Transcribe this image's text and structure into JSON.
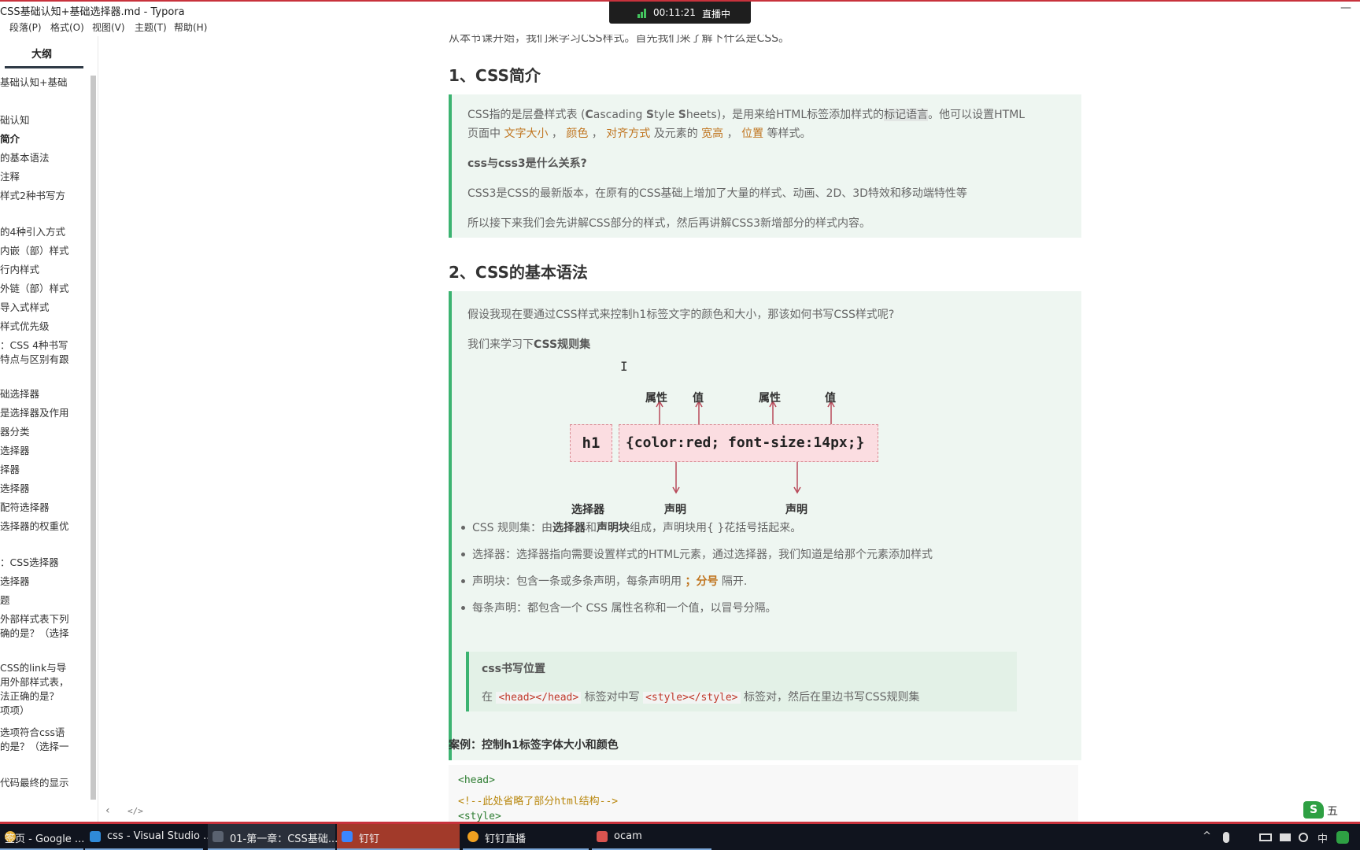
{
  "window": {
    "title": "CSS基础认知+基础选择器.md - Typora",
    "minimize_glyph": "—"
  },
  "live": {
    "time": "00:11:21",
    "label": "直播中"
  },
  "menu": [
    "段落(P)",
    "格式(O)",
    "视图(V)",
    "主题(T)",
    "帮助(H)"
  ],
  "sidebar": {
    "tab": "大纲",
    "items": [
      {
        "label": "基础认知+基础",
        "bold": false
      },
      {
        "label": "础认知",
        "bold": false
      },
      {
        "label": "简介",
        "bold": true
      },
      {
        "label": "的基本语法",
        "bold": false
      },
      {
        "label": "注释",
        "bold": false
      },
      {
        "label": "样式2种书写方",
        "bold": false
      },
      {
        "label": "的4种引入方式",
        "bold": false
      },
      {
        "label": "内嵌（部）样式",
        "bold": false
      },
      {
        "label": "行内样式",
        "bold": false
      },
      {
        "label": "外链（部）样式",
        "bold": false
      },
      {
        "label": "导入式样式",
        "bold": false
      },
      {
        "label": "样式优先级",
        "bold": false
      },
      {
        "label": "：CSS 4种书写",
        "bold": false
      },
      {
        "label": "特点与区别有跟",
        "bold": false
      },
      {
        "label": "础选择器",
        "bold": false
      },
      {
        "label": "是选择器及作用",
        "bold": false
      },
      {
        "label": "器分类",
        "bold": false
      },
      {
        "label": "选择器",
        "bold": false
      },
      {
        "label": "择器",
        "bold": false
      },
      {
        "label": "选择器",
        "bold": false
      },
      {
        "label": "配符选择器",
        "bold": false
      },
      {
        "label": "选择器的权重优",
        "bold": false
      },
      {
        "label": "：CSS选择器",
        "bold": false
      },
      {
        "label": "选择器",
        "bold": false
      },
      {
        "label": "题",
        "bold": false
      },
      {
        "label": "外部样式表下列",
        "bold": false
      },
      {
        "label": "确的是？（选择",
        "bold": false
      },
      {
        "label": "CSS的link与导",
        "bold": false
      },
      {
        "label": "用外部样式表，",
        "bold": false
      },
      {
        "label": "法正确的是？",
        "bold": false
      },
      {
        "label": "项项）",
        "bold": false
      },
      {
        "label": "选项符合css语",
        "bold": false
      },
      {
        "label": "的是？（选择一",
        "bold": false
      },
      {
        "label": "代码最终的显示",
        "bold": false
      }
    ],
    "footer_left": "‹",
    "footer_right": "</>"
  },
  "doc": {
    "cut_line": "从本节课开始，我们来学习CSS样式。首先我们来了解下什么是CSS。",
    "h1": "1、CSS简介",
    "intro": {
      "p1_a": "CSS指的是层叠样式表 (",
      "p1_C": "C",
      "p1_b": "ascading ",
      "p1_S": "S",
      "p1_c": "tyle ",
      "p1_S2": "S",
      "p1_d": "heets)，是用来给HTML标签添加样式的",
      "p1_hl": "标记语言",
      "p1_e": "。他可以设置HTML",
      "p2_a": "页面中 ",
      "p2_o1": "文字大小",
      "p2_s1": " ， ",
      "p2_o2": "颜色",
      "p2_s2": " ， ",
      "p2_o3": "对齐方式",
      "p2_b": " 及元素的 ",
      "p2_o4": "宽高",
      "p2_s3": " ， ",
      "p2_o5": "位置",
      "p2_c": " 等样式。",
      "q": "css与css3是什么关系?",
      "p3": "CSS3是CSS的最新版本，在原有的CSS基础上增加了大量的样式、动画、2D、3D特效和移动端特性等",
      "p4": "所以接下来我们会先讲解CSS部分的样式，然后再讲解CSS3新增部分的样式内容。"
    },
    "h2": "2、CSS的基本语法",
    "syntax": {
      "p1": "假设我现在要通过CSS样式来控制h1标签文字的颜色和大小，那该如何书写CSS样式呢?",
      "p2_a": "我们来学习下",
      "p2_b": "CSS规则集",
      "diagram": {
        "selector": "h1",
        "rule": "{color:red; font-size:14px;}",
        "prop1": "属性",
        "val1": "值",
        "prop2": "属性",
        "val2": "值",
        "sel_label": "选择器",
        "decl1": "声明",
        "decl2": "声明"
      },
      "b1_a": "CSS 规则集：由",
      "b1_b": "选择器",
      "b1_c": "和",
      "b1_d": "声明块",
      "b1_e": "组成，声明块用{ }花括号括起来。",
      "b2": "选择器：选择器指向需要设置样式的HTML元素，通过选择器，我们知道是给那个元素添加样式",
      "b3_a": "声明块：包含一条或多条声明，每条声明用 ",
      "b3_o": "；分号",
      "b3_b": " 隔开.",
      "b4": "每条声明：都包含一个 CSS 属性名称和一个值，以冒号分隔。",
      "pos_title": "css书写位置",
      "pos_a": "在 ",
      "pos_c1": "<head></head>",
      "pos_b": " 标签对中写 ",
      "pos_c2": "<style></style>",
      "pos_c": " 标签对，然后在里边书写CSS规则集"
    },
    "case_title": "案例：控制h1标签字体大小和颜色",
    "code": [
      "<head>",
      "    <!--此处省略了部分html结构-->",
      "    <style>"
    ]
  },
  "logo": {
    "mark": "S",
    "text": "五"
  },
  "taskbar": {
    "items": [
      {
        "label": "签页 - Google ...",
        "color": "#e8b23a"
      },
      {
        "label": "css - Visual Studio ...",
        "color": "#2f8ad8"
      },
      {
        "label": "01-第一章：CSS基础...",
        "color": "#444a54"
      },
      {
        "label": "钉钉",
        "color": "#3a86ff"
      },
      {
        "label": "钉钉直播",
        "color": "#f0a020"
      },
      {
        "label": "ocam",
        "color": "#d9534f"
      }
    ],
    "tray": {
      "caret": "^",
      "ime": "中"
    },
    "colors": {
      "active": "#2a2f3a",
      "accent": "#c8323c"
    }
  }
}
